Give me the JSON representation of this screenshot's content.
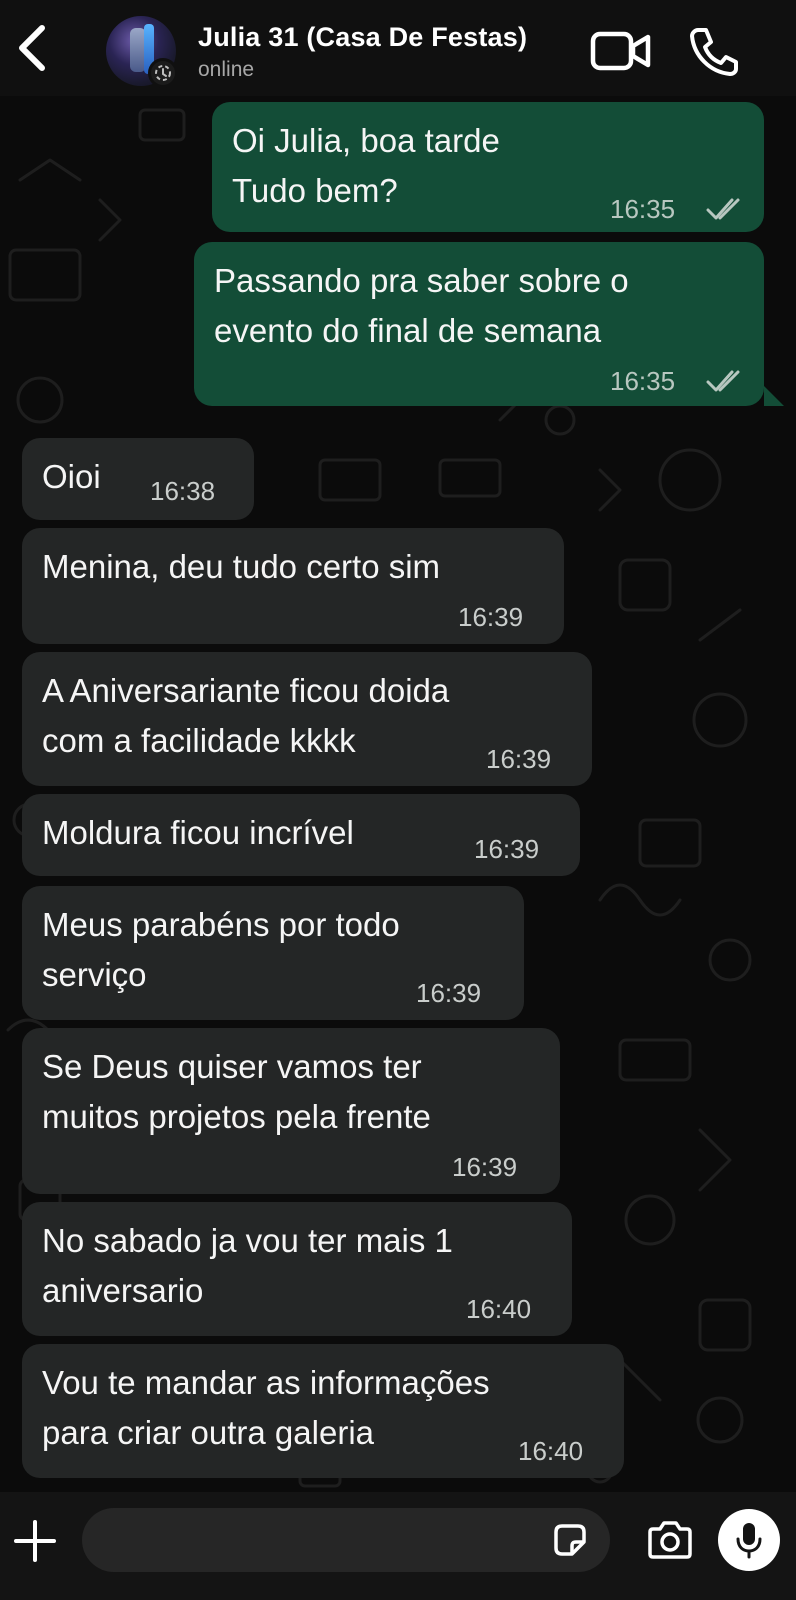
{
  "header": {
    "back_icon": "chevron-left-icon",
    "contact_name": "Julia 31 (Casa De Festas)",
    "status": "online",
    "video_icon": "video-camera-icon",
    "call_icon": "phone-icon"
  },
  "messages": [
    {
      "direction": "outgoing",
      "lines": [
        "Oi Julia, boa tarde",
        "Tudo bem?"
      ],
      "time": "16:35",
      "status": "read"
    },
    {
      "direction": "outgoing",
      "lines": [
        "Passando pra saber sobre o",
        "evento do final de semana"
      ],
      "time": "16:35",
      "status": "read"
    },
    {
      "direction": "incoming",
      "lines": [
        "Oioi"
      ],
      "time": "16:38"
    },
    {
      "direction": "incoming",
      "lines": [
        "Menina, deu tudo certo sim"
      ],
      "time": "16:39"
    },
    {
      "direction": "incoming",
      "lines": [
        "A Aniversariante ficou doida",
        "com a facilidade kkkk"
      ],
      "time": "16:39"
    },
    {
      "direction": "incoming",
      "lines": [
        "Moldura ficou incrível"
      ],
      "time": "16:39"
    },
    {
      "direction": "incoming",
      "lines": [
        "Meus parabéns por todo",
        "serviço"
      ],
      "time": "16:39"
    },
    {
      "direction": "incoming",
      "lines": [
        "Se Deus quiser vamos ter",
        "muitos projetos pela frente"
      ],
      "time": "16:39"
    },
    {
      "direction": "incoming",
      "lines": [
        "No sabado ja vou ter mais 1",
        "aniversario"
      ],
      "time": "16:40"
    },
    {
      "direction": "incoming",
      "lines": [
        "Vou te mandar as informações",
        "para criar outra galeria"
      ],
      "time": "16:40"
    }
  ],
  "composer": {
    "input_value": "",
    "plus_icon": "plus-icon",
    "sticker_icon": "sticker-icon",
    "camera_icon": "camera-icon",
    "mic_icon": "microphone-icon"
  },
  "colors": {
    "background": "#0b0b0b",
    "outgoing_bubble": "#134d37",
    "incoming_bubble": "#242626",
    "read_ticks": "#b8c7c0"
  }
}
